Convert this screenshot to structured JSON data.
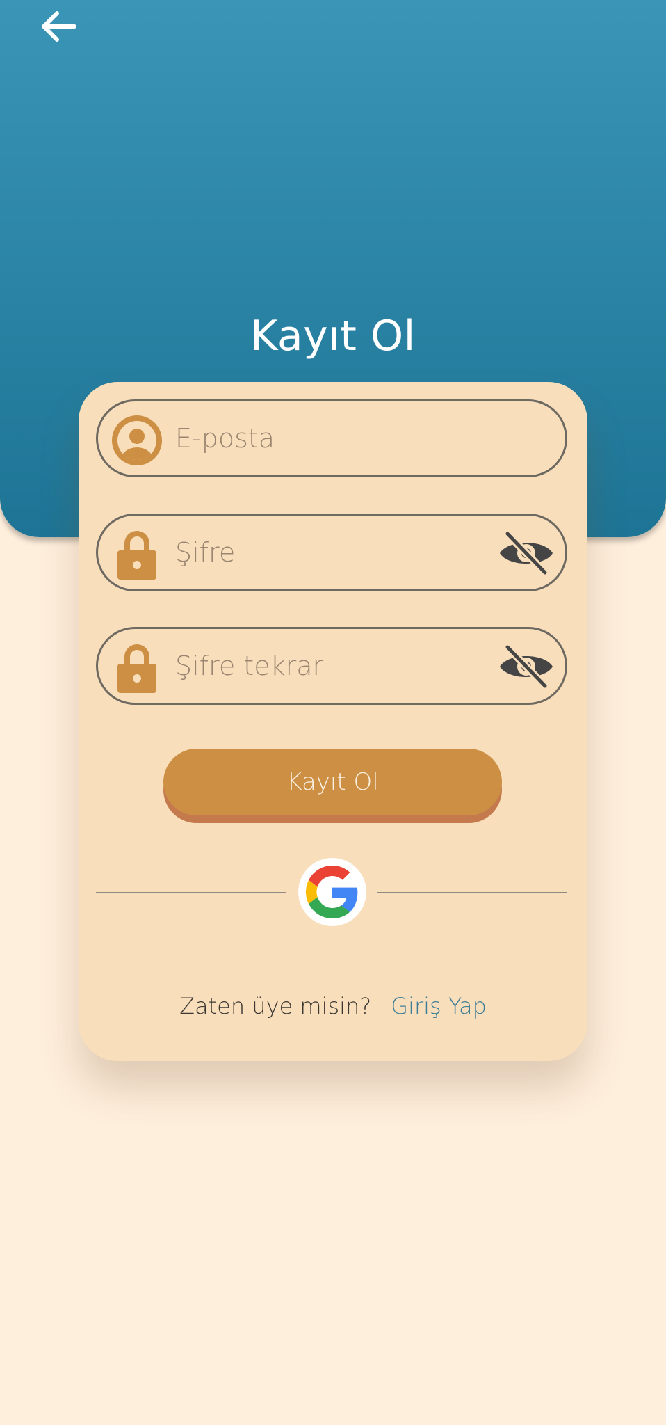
{
  "header": {
    "title": "Kayıt Ol",
    "back_icon": "arrow-left-icon"
  },
  "form": {
    "email": {
      "placeholder": "E-posta",
      "icon": "user-icon"
    },
    "password": {
      "placeholder": "Şifre",
      "icon": "lock-icon",
      "toggle_icon": "eye-off-icon"
    },
    "password_confirm": {
      "placeholder": "Şifre tekrar",
      "icon": "lock-icon",
      "toggle_icon": "eye-off-icon"
    },
    "submit_label": "Kayıt Ol",
    "google_icon": "google-icon"
  },
  "footer": {
    "prompt": "Zaten üye misin?",
    "link": "Giriş Yap"
  },
  "colors": {
    "header_gradient_top": "#3A95B6",
    "header_gradient_bottom": "#1D7495",
    "background": "#FEEEDC",
    "card": "#F8DEBB",
    "accent": "#CC8F44",
    "link": "#3D7D97"
  }
}
